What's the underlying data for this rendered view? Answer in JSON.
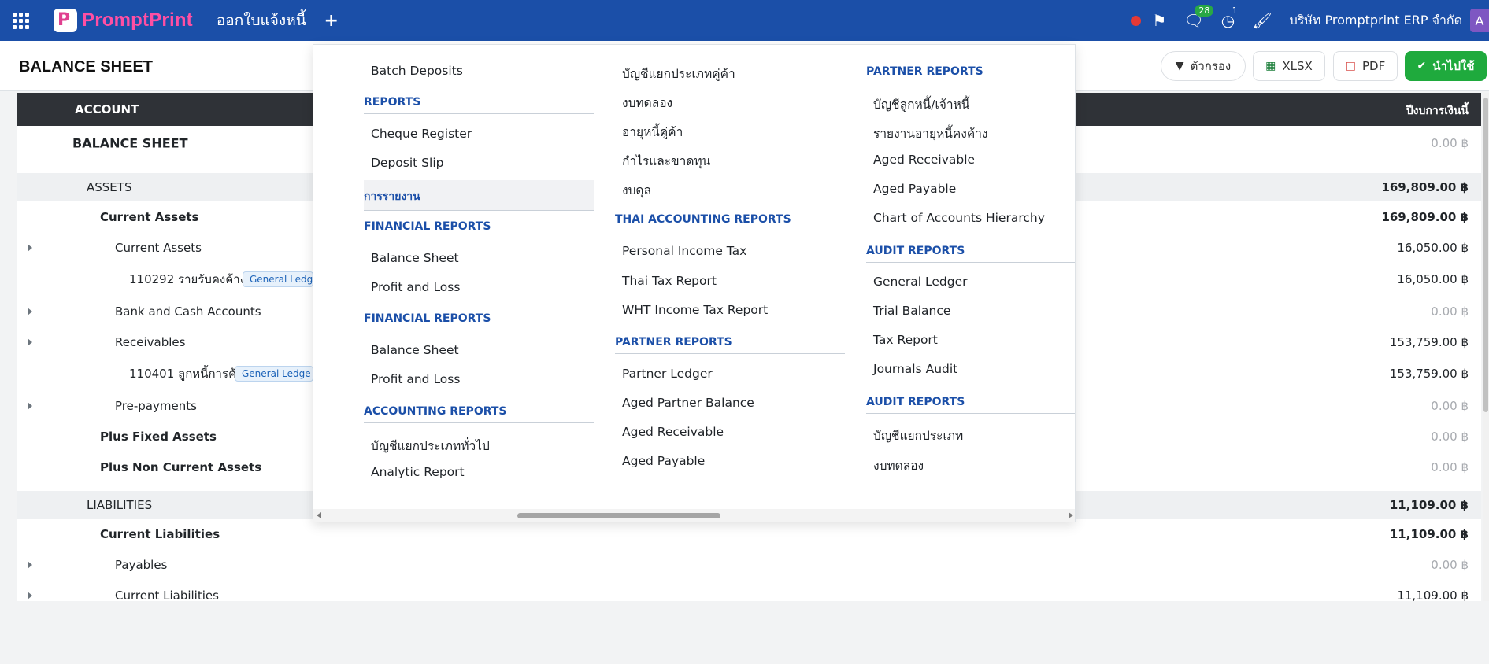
{
  "navbar": {
    "brand_first": "Prompt",
    "brand_second": "Print",
    "title": "ออกใบแจ้งหนี้",
    "plus": "+",
    "messages_count": "28",
    "activity_count": "1",
    "company": "บริษัท Promptprint ERP จำกัด",
    "avatar_letter": "A"
  },
  "control_panel": {
    "title": "BALANCE SHEET",
    "filter_label": "ตัวกรอง",
    "xlsx_label": "XLSX",
    "pdf_label": "PDF",
    "apply_label": "นำไปใช้"
  },
  "report": {
    "headers": {
      "account": "ACCOUNT",
      "balance": "ปีงบการเงินนี้"
    },
    "rows": [
      {
        "name": "BALANCE SHEET",
        "value": "0.00 ฿"
      },
      {
        "name": "ASSETS",
        "value": "169,809.00 ฿"
      },
      {
        "name": "Current Assets",
        "value": "169,809.00 ฿"
      },
      {
        "name": "Current Assets",
        "value": "16,050.00 ฿"
      },
      {
        "name": "110292 รายรับคงค้าง",
        "tag": "General Ledg",
        "value": "16,050.00 ฿"
      },
      {
        "name": "Bank and Cash Accounts",
        "value": "0.00 ฿"
      },
      {
        "name": "Receivables",
        "value": "153,759.00 ฿"
      },
      {
        "name": "110401 ลูกหนี้การค้า",
        "tag": "General Ledge",
        "value": "153,759.00 ฿"
      },
      {
        "name": "Pre-payments",
        "value": "0.00 ฿"
      },
      {
        "name": "Plus Fixed Assets",
        "value": "0.00 ฿"
      },
      {
        "name": "Plus Non Current Assets",
        "value": "0.00 ฿"
      },
      {
        "name": "LIABILITIES",
        "value": "11,109.00 ฿"
      },
      {
        "name": "Current Liabilities",
        "value": "11,109.00 ฿"
      },
      {
        "name": "Payables",
        "value": "0.00 ฿"
      },
      {
        "name": "Current Liabilities",
        "value": "11,109.00 ฿"
      }
    ]
  },
  "menu": {
    "col1": {
      "batch_deposits": "Batch Deposits",
      "reports_header": "REPORTS",
      "cheque_register": "Cheque Register",
      "deposit_slip": "Deposit Slip",
      "thai_reports_header": "การรายงาน",
      "financial_header_1": "FINANCIAL REPORTS",
      "balance_sheet_1": "Balance Sheet",
      "profit_loss_1": "Profit and Loss",
      "financial_header_2": "FINANCIAL REPORTS",
      "balance_sheet_2": "Balance Sheet",
      "profit_loss_2": "Profit and Loss",
      "accounting_header": "ACCOUNTING REPORTS",
      "general_ledger_th": "บัญชีแยกประเภททั่วไป",
      "analytic_report": "Analytic Report"
    },
    "col2": {
      "partner_ledger_th": "บัญชีแยกประเภทคู่ค้า",
      "trial_balance_th": "งบทดลอง",
      "aged_partner_th": "อายุหนี้คู่ค้า",
      "profit_loss_th": "กำไรและขาดทุน",
      "balance_th": "งบดุล",
      "thai_accounting_header": "THAI ACCOUNTING REPORTS",
      "personal_income_tax": "Personal Income Tax",
      "thai_tax_report": "Thai Tax Report",
      "wht_income_tax": "WHT Income Tax Report",
      "partner_header": "PARTNER REPORTS",
      "partner_ledger": "Partner Ledger",
      "aged_partner_balance": "Aged Partner Balance",
      "aged_receivable": "Aged Receivable",
      "aged_payable": "Aged Payable"
    },
    "col3": {
      "partner_header": "PARTNER REPORTS",
      "ar_ap_th": "บัญชีลูกหนี้/เจ้าหนี้",
      "aging_outstanding_th": "รายงานอายุหนี้คงค้าง",
      "aged_receivable": "Aged Receivable",
      "aged_payable": "Aged Payable",
      "coa_hierarchy": "Chart of Accounts Hierarchy",
      "audit_header_1": "AUDIT REPORTS",
      "general_ledger": "General Ledger",
      "trial_balance": "Trial Balance",
      "tax_report": "Tax Report",
      "journals_audit": "Journals Audit",
      "audit_header_2": "AUDIT REPORTS",
      "ledger_th": "บัญชีแยกประเภท",
      "trial_balance_th": "งบทดลอง"
    }
  }
}
